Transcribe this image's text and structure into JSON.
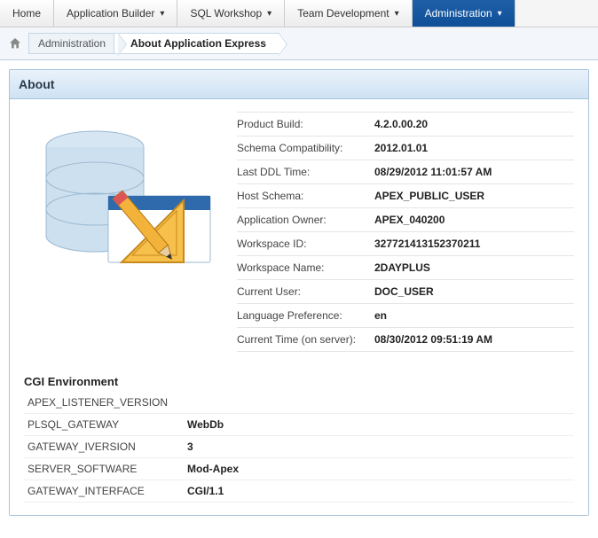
{
  "nav": {
    "tabs": [
      {
        "label": "Home",
        "dropdown": false,
        "active": false
      },
      {
        "label": "Application Builder",
        "dropdown": true,
        "active": false
      },
      {
        "label": "SQL Workshop",
        "dropdown": true,
        "active": false
      },
      {
        "label": "Team Development",
        "dropdown": true,
        "active": false
      },
      {
        "label": "Administration",
        "dropdown": true,
        "active": true
      }
    ]
  },
  "breadcrumb": {
    "items": [
      {
        "label": "Administration",
        "current": false
      },
      {
        "label": "About Application Express",
        "current": true
      }
    ]
  },
  "region": {
    "title": "About"
  },
  "about": {
    "rows": [
      {
        "label": "Product Build:",
        "value": "4.2.0.00.20"
      },
      {
        "label": "Schema Compatibility:",
        "value": "2012.01.01"
      },
      {
        "label": "Last DDL Time:",
        "value": "08/29/2012 11:01:57 AM"
      },
      {
        "label": "Host Schema:",
        "value": "APEX_PUBLIC_USER"
      },
      {
        "label": "Application Owner:",
        "value": "APEX_040200"
      },
      {
        "label": "Workspace ID:",
        "value": "327721413152370211"
      },
      {
        "label": "Workspace Name:",
        "value": "2DAYPLUS"
      },
      {
        "label": "Current User:",
        "value": "DOC_USER"
      },
      {
        "label": "Language Preference:",
        "value": "en"
      },
      {
        "label": "Current Time (on server):",
        "value": "08/30/2012 09:51:19 AM"
      }
    ]
  },
  "cgi": {
    "title": "CGI Environment",
    "rows": [
      {
        "key": "APEX_LISTENER_VERSION",
        "value": ""
      },
      {
        "key": "PLSQL_GATEWAY",
        "value": "WebDb"
      },
      {
        "key": "GATEWAY_IVERSION",
        "value": "3"
      },
      {
        "key": "SERVER_SOFTWARE",
        "value": "Mod-Apex"
      },
      {
        "key": "GATEWAY_INTERFACE",
        "value": "CGI/1.1"
      }
    ]
  }
}
